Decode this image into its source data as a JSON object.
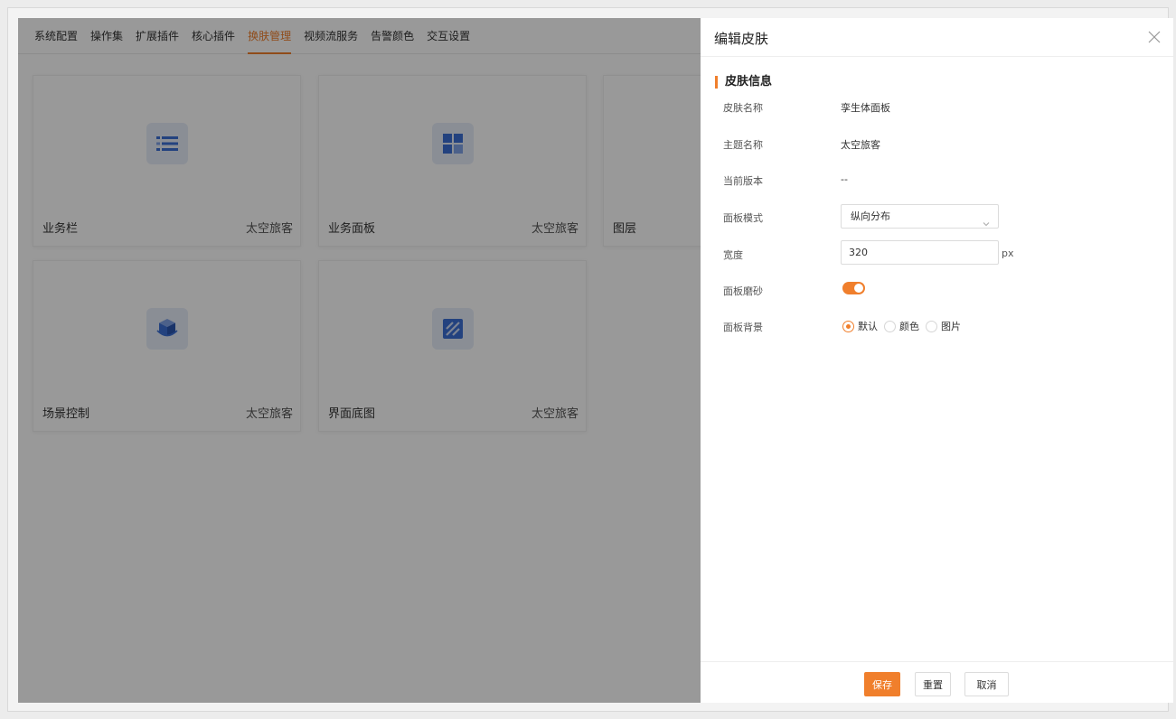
{
  "nav": {
    "items": [
      "系统配置",
      "操作集",
      "扩展插件",
      "核心插件",
      "换肤管理",
      "视频流服务",
      "告警颜色",
      "交互设置"
    ],
    "active": "换肤管理"
  },
  "cards": [
    {
      "name": "业务栏",
      "theme": "太空旅客",
      "icon": "list-icon"
    },
    {
      "name": "业务面板",
      "theme": "太空旅客",
      "icon": "grid-icon"
    },
    {
      "name": "图层",
      "theme": "",
      "icon": ""
    },
    {
      "name": "场景控制",
      "theme": "太空旅客",
      "icon": "cube-icon"
    },
    {
      "name": "界面底图",
      "theme": "太空旅客",
      "icon": "image-icon"
    }
  ],
  "drawer": {
    "title": "编辑皮肤",
    "section_title": "皮肤信息",
    "skin_name_label": "皮肤名称",
    "skin_name_value": "孪生体面板",
    "theme_name_label": "主题名称",
    "theme_name_value": "太空旅客",
    "version_label": "当前版本",
    "version_value": "--",
    "panel_mode_label": "面板模式",
    "panel_mode_value": "纵向分布",
    "width_label": "宽度",
    "width_value": "320",
    "width_unit": "px",
    "frosted_label": "面板磨砂",
    "frosted_on": true,
    "background_label": "面板背景",
    "background_options": [
      "默认",
      "颜色",
      "图片"
    ],
    "background_selected": "默认",
    "buttons": {
      "save": "保存",
      "reset": "重置",
      "cancel": "取消"
    }
  },
  "colors": {
    "accent": "#f07f2c",
    "icon_blue": "#3b6fd4",
    "icon_bg": "#e7edf8"
  }
}
